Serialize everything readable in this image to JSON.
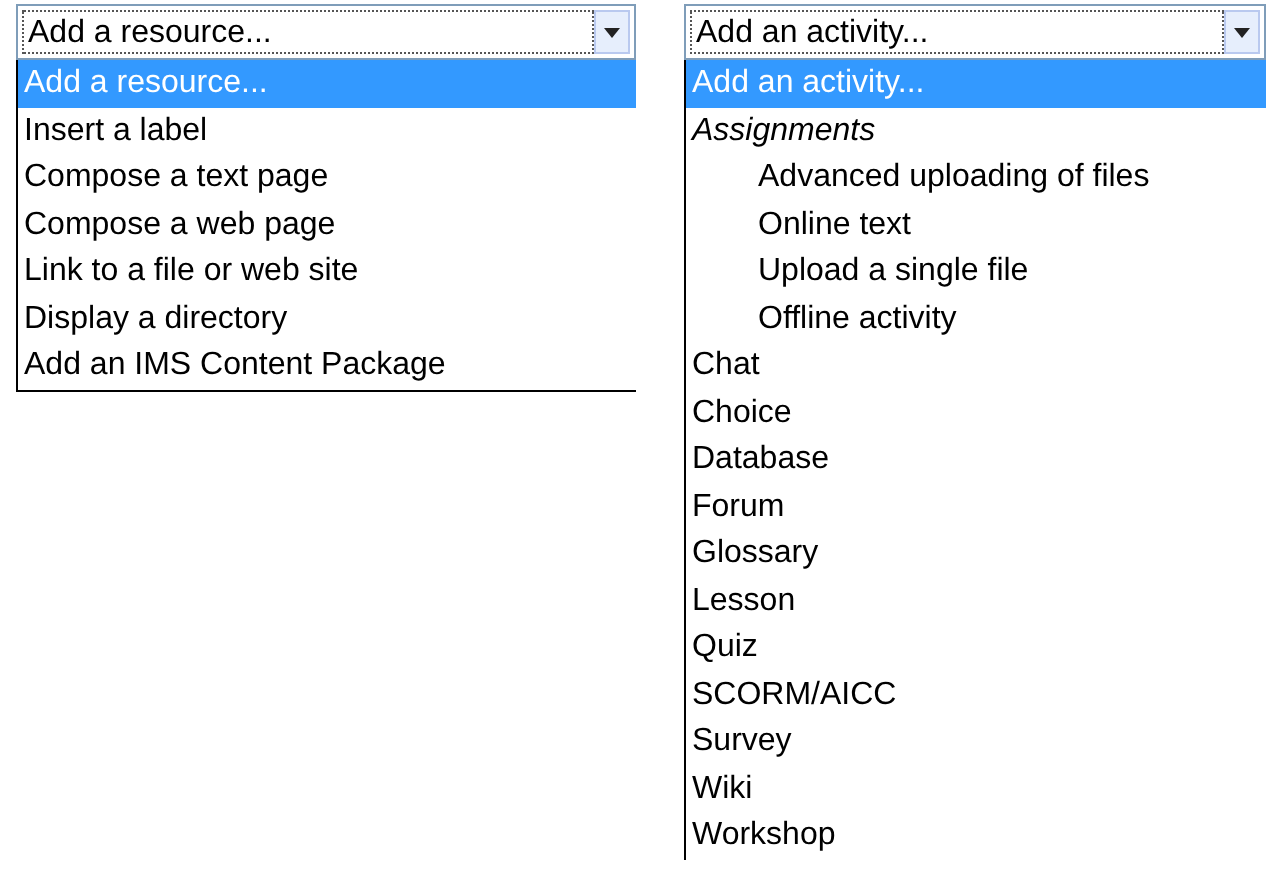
{
  "resource_select": {
    "value": "Add a resource...",
    "items": [
      {
        "label": "Add a resource...",
        "selected": true
      },
      {
        "label": "Insert a label",
        "selected": false
      },
      {
        "label": "Compose a text page",
        "selected": false
      },
      {
        "label": "Compose a web page",
        "selected": false
      },
      {
        "label": "Link to a file or web site",
        "selected": false
      },
      {
        "label": "Display a directory",
        "selected": false
      },
      {
        "label": "Add an IMS Content Package",
        "selected": false
      }
    ]
  },
  "activity_select": {
    "value": "Add an activity...",
    "items": [
      {
        "label": "Add an activity...",
        "selected": true
      },
      {
        "group": "Assignments",
        "options": [
          {
            "label": "Advanced uploading of files",
            "selected": false
          },
          {
            "label": "Online text",
            "selected": false
          },
          {
            "label": "Upload a single file",
            "selected": false
          },
          {
            "label": "Offline activity",
            "selected": false
          }
        ]
      },
      {
        "label": "Chat",
        "selected": false
      },
      {
        "label": "Choice",
        "selected": false
      },
      {
        "label": "Database",
        "selected": false
      },
      {
        "label": "Forum",
        "selected": false
      },
      {
        "label": "Glossary",
        "selected": false
      },
      {
        "label": "Lesson",
        "selected": false
      },
      {
        "label": "Quiz",
        "selected": false
      },
      {
        "label": "SCORM/AICC",
        "selected": false
      },
      {
        "label": "Survey",
        "selected": false
      },
      {
        "label": "Wiki",
        "selected": false
      },
      {
        "label": "Workshop",
        "selected": false
      }
    ]
  }
}
